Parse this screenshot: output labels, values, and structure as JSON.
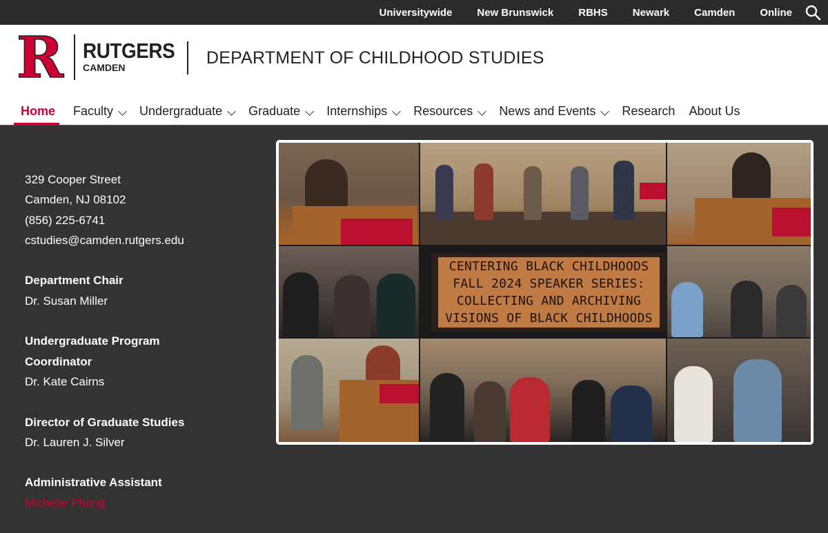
{
  "topbar": {
    "links": [
      "Universitywide",
      "New Brunswick",
      "RBHS",
      "Newark",
      "Camden",
      "Online"
    ],
    "search_icon": "search-icon"
  },
  "header": {
    "logo_letter": "R",
    "logo_word": "RUTGERS",
    "logo_sub": "CAMDEN",
    "dept_title": "DEPARTMENT OF CHILDHOOD STUDIES"
  },
  "nav": [
    {
      "label": "Home",
      "active": true
    },
    {
      "label": "Faculty",
      "dropdown": true
    },
    {
      "label": "Undergraduate",
      "dropdown": true
    },
    {
      "label": "Graduate",
      "dropdown": true
    },
    {
      "label": "Internships",
      "dropdown": true
    },
    {
      "label": "Resources",
      "dropdown": true
    },
    {
      "label": "News and Events",
      "dropdown": true
    },
    {
      "label": "Research"
    },
    {
      "label": "About Us"
    }
  ],
  "contact": {
    "address1": "329 Cooper Street",
    "address2": "Camden, NJ 08102",
    "phone": "(856) 225-6741",
    "email": "cstudies@camden.rutgers.edu",
    "chair_label": "Department Chair",
    "chair_name": "Dr. Susan Miller",
    "ug_label_1": "Undergraduate Program",
    "ug_label_2": "Coordinator",
    "ug_name": "Dr. Kate Cairns",
    "grad_label": "Director of Graduate Studies",
    "grad_name": "Dr. Lauren J. Silver",
    "admin_label": "Administrative Assistant",
    "admin_name": "Michelle Phang"
  },
  "banner": {
    "lines": [
      "CENTERING BLACK CHILDHOODS",
      "FALL 2024 SPEAKER SERIES:",
      "COLLECTING AND ARCHIVING",
      "VISIONS OF BLACK CHILDHOODS"
    ]
  },
  "colors": {
    "brand_red": "#cc0033",
    "dark_bg": "#333333",
    "topbar": "#2b2b2b"
  }
}
